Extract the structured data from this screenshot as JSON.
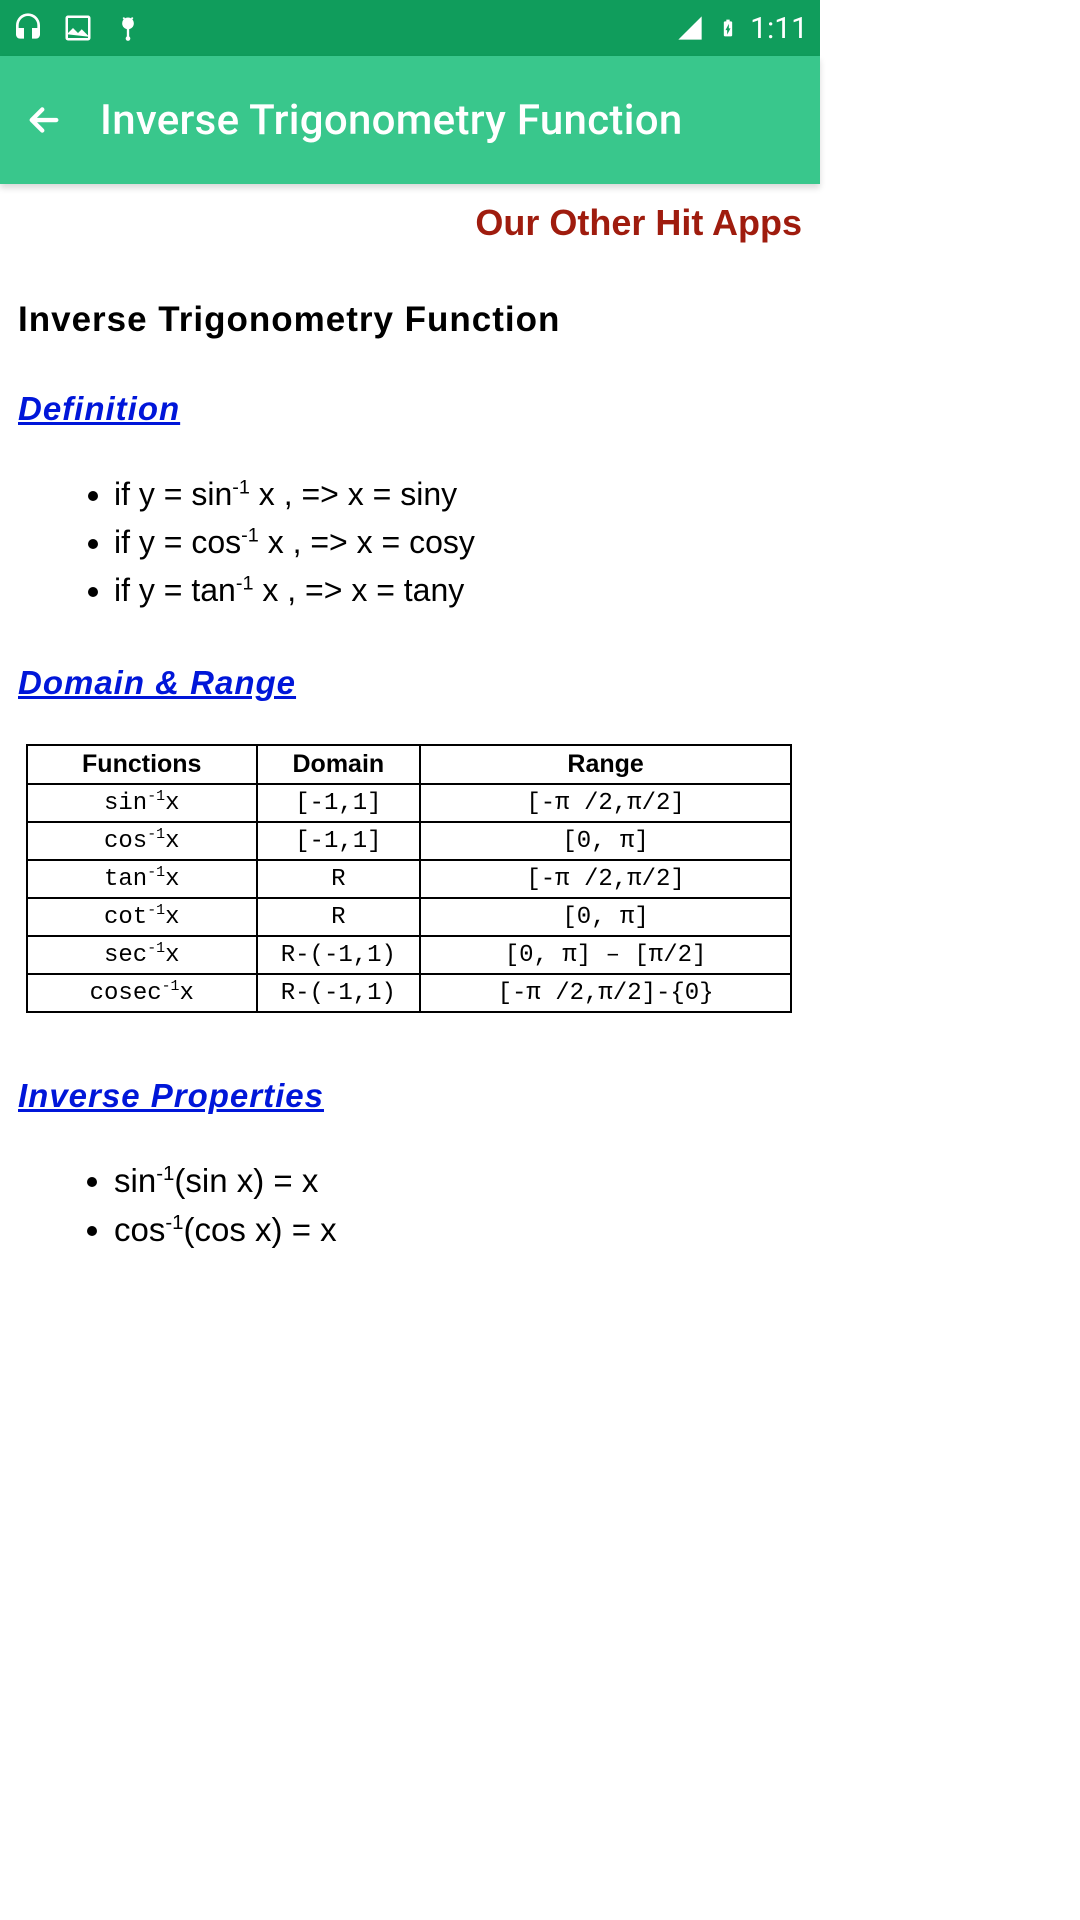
{
  "status": {
    "time": "1:11"
  },
  "appbar": {
    "title": "Inverse Trigonometry Function"
  },
  "promo": {
    "label": "Our Other Hit Apps"
  },
  "page": {
    "heading": "Inverse Trigonometry Function"
  },
  "sections": {
    "definition": {
      "title": "Definition"
    },
    "domain_range": {
      "title": "Domain & Range"
    },
    "inverse_props": {
      "title": "Inverse Properties"
    }
  },
  "definitions": [
    {
      "pre": "if y = sin",
      "sup": "-1",
      "post": " x , => x = siny"
    },
    {
      "pre": "if y = cos",
      "sup": "-1",
      "post": " x , => x = cosy"
    },
    {
      "pre": "if y = tan",
      "sup": "-1",
      "post": " x , => x = tany"
    }
  ],
  "table": {
    "headers": {
      "functions": "Functions",
      "domain": "Domain",
      "range": "Range"
    },
    "rows": [
      {
        "fn_pre": "sin",
        "fn_sup": "-1",
        "fn_post": "x",
        "domain": "[-1,1]",
        "range": "[-π /2,π/2]"
      },
      {
        "fn_pre": "cos",
        "fn_sup": "-1",
        "fn_post": "x",
        "domain": "[-1,1]",
        "range": "[0, π]"
      },
      {
        "fn_pre": "tan",
        "fn_sup": "-1",
        "fn_post": "x",
        "domain": "R",
        "range": "[-π /2,π/2]"
      },
      {
        "fn_pre": "cot",
        "fn_sup": "-1",
        "fn_post": "x",
        "domain": "R",
        "range": "[0, π]"
      },
      {
        "fn_pre": "sec",
        "fn_sup": "-1",
        "fn_post": "x",
        "domain": "R-(-1,1)",
        "range": "[0, π] – [π/2]"
      },
      {
        "fn_pre": "cosec",
        "fn_sup": "-1",
        "fn_post": "x",
        "domain": "R-(-1,1)",
        "range": "[-π /2,π/2]-{0}"
      }
    ]
  },
  "properties": [
    {
      "pre": "sin",
      "sup": "-1",
      "post": "(sin x) = x"
    },
    {
      "pre": "cos",
      "sup": "-1",
      "post": "(cos x) = x"
    }
  ]
}
